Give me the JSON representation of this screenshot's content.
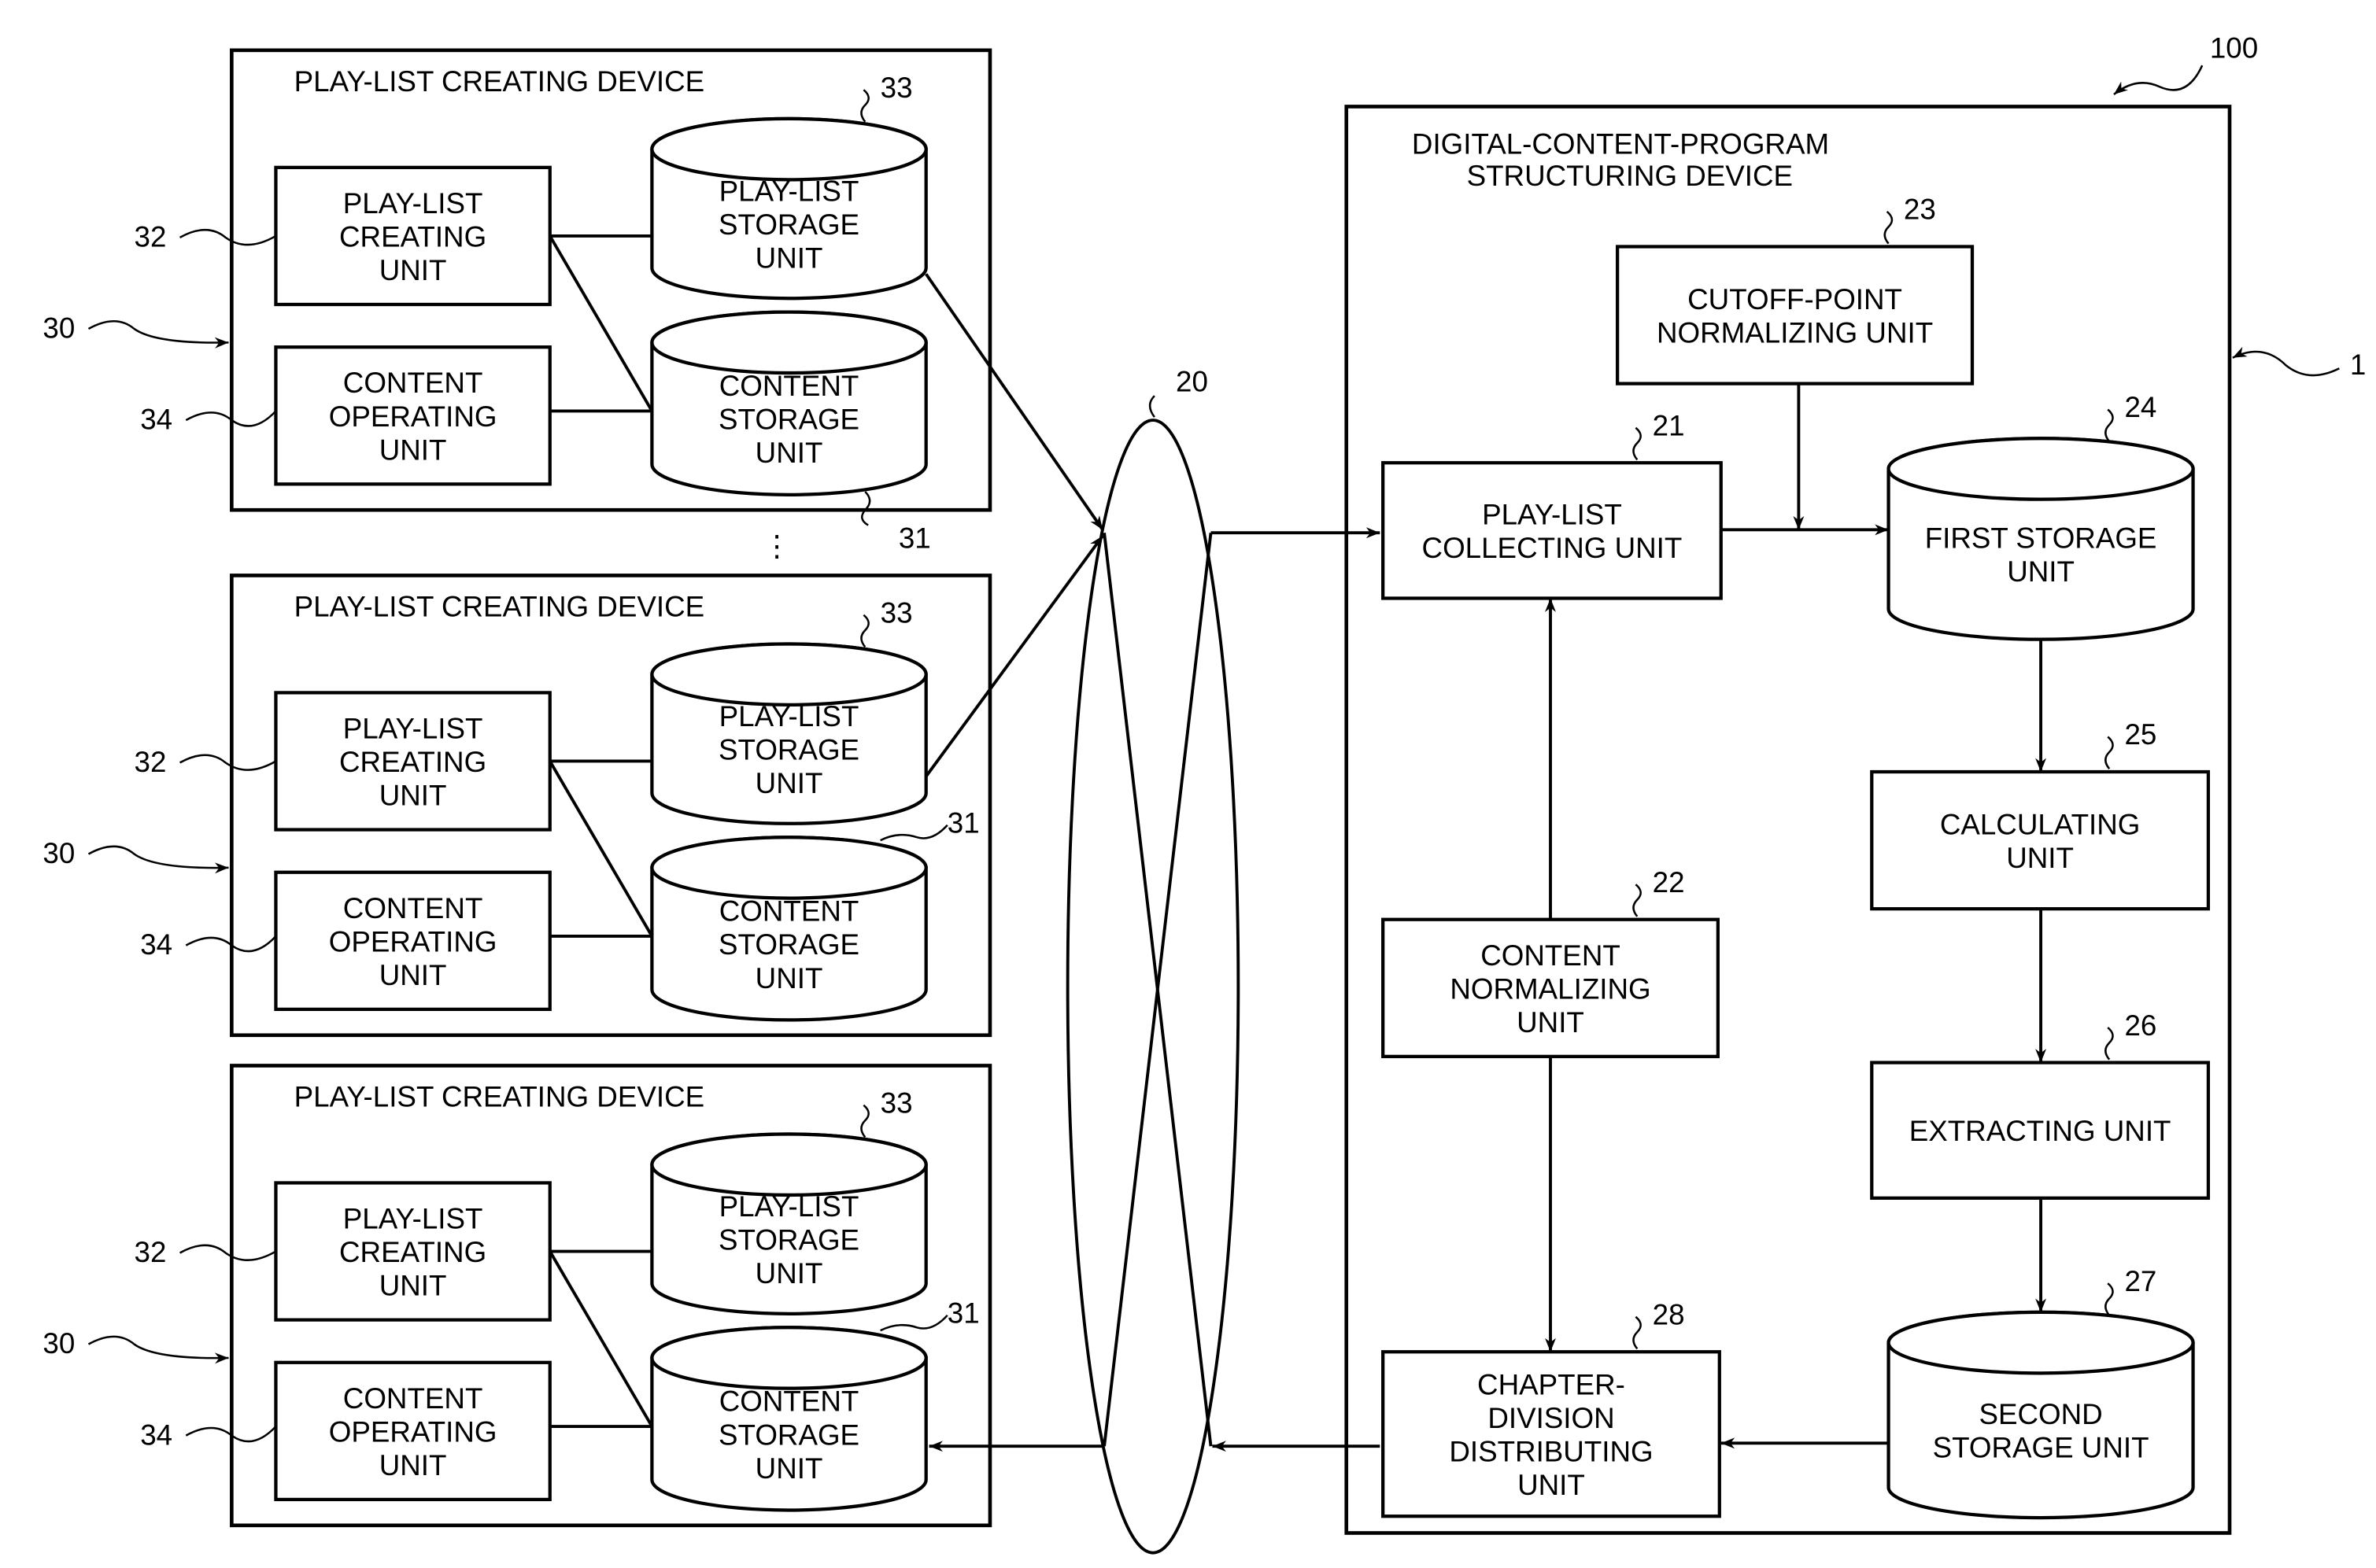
{
  "figure": {
    "system_ref": "100",
    "network_ref": "20",
    "structuring_device": {
      "ref": "1",
      "title_line1": "DIGITAL-CONTENT-PROGRAM",
      "title_line2": "STRUCTURING DEVICE",
      "units": {
        "collecting": {
          "ref": "21",
          "lines": [
            "PLAY-LIST",
            "COLLECTING UNIT"
          ]
        },
        "content_normalizing": {
          "ref": "22",
          "lines": [
            "CONTENT",
            "NORMALIZING",
            "UNIT"
          ]
        },
        "cutoff_normalizing": {
          "ref": "23",
          "lines": [
            "CUTOFF-POINT",
            "NORMALIZING UNIT"
          ]
        },
        "first_storage": {
          "ref": "24",
          "lines": [
            "FIRST STORAGE",
            "UNIT"
          ]
        },
        "calculating": {
          "ref": "25",
          "lines": [
            "CALCULATING",
            "UNIT"
          ]
        },
        "extracting": {
          "ref": "26",
          "lines": [
            "EXTRACTING UNIT"
          ]
        },
        "second_storage": {
          "ref": "27",
          "lines": [
            "SECOND",
            "STORAGE UNIT"
          ]
        },
        "distributing": {
          "ref": "28",
          "lines": [
            "CHAPTER-",
            "DIVISION",
            "DISTRIBUTING",
            "UNIT"
          ]
        }
      }
    },
    "creating_devices": [
      {
        "ref": "30",
        "title": "PLAY-LIST CREATING DEVICE",
        "creating_unit": {
          "ref": "32",
          "lines": [
            "PLAY-LIST",
            "CREATING",
            "UNIT"
          ]
        },
        "operating_unit": {
          "ref": "34",
          "lines": [
            "CONTENT",
            "OPERATING",
            "UNIT"
          ]
        },
        "playlist_storage": {
          "ref": "33",
          "lines": [
            "PLAY-LIST",
            "STORAGE",
            "UNIT"
          ]
        },
        "content_storage": {
          "ref": "31",
          "lines": [
            "CONTENT",
            "STORAGE",
            "UNIT"
          ]
        }
      },
      {
        "ref": "30",
        "title": "PLAY-LIST CREATING DEVICE",
        "creating_unit": {
          "ref": "32",
          "lines": [
            "PLAY-LIST",
            "CREATING",
            "UNIT"
          ]
        },
        "operating_unit": {
          "ref": "34",
          "lines": [
            "CONTENT",
            "OPERATING",
            "UNIT"
          ]
        },
        "playlist_storage": {
          "ref": "33",
          "lines": [
            "PLAY-LIST",
            "STORAGE",
            "UNIT"
          ]
        },
        "content_storage": {
          "ref": "31",
          "lines": [
            "CONTENT",
            "STORAGE",
            "UNIT"
          ]
        }
      },
      {
        "ref": "30",
        "title": "PLAY-LIST CREATING DEVICE",
        "creating_unit": {
          "ref": "32",
          "lines": [
            "PLAY-LIST",
            "CREATING",
            "UNIT"
          ]
        },
        "operating_unit": {
          "ref": "34",
          "lines": [
            "CONTENT",
            "OPERATING",
            "UNIT"
          ]
        },
        "playlist_storage": {
          "ref": "33",
          "lines": [
            "PLAY-LIST",
            "STORAGE",
            "UNIT"
          ]
        },
        "content_storage": {
          "ref": "31",
          "lines": [
            "CONTENT",
            "STORAGE",
            "UNIT"
          ]
        }
      }
    ],
    "ellipsis": "⋮"
  }
}
